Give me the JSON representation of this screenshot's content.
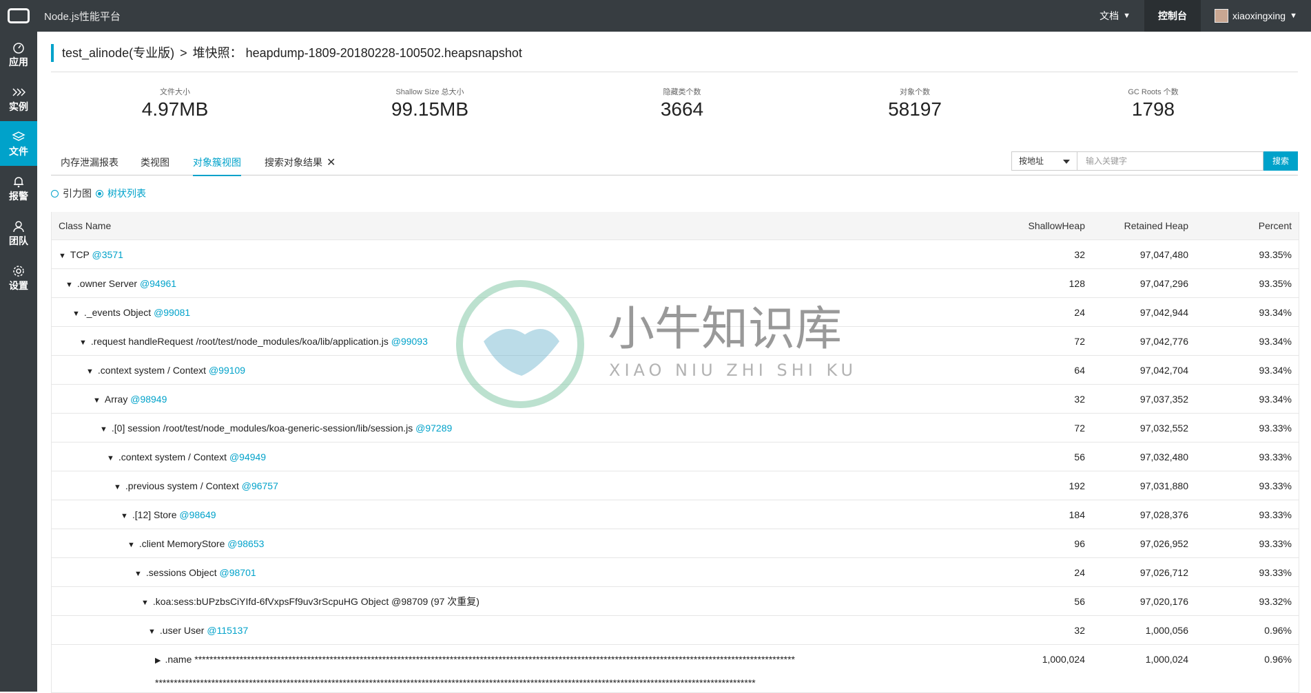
{
  "app": {
    "title": "Node.js性能平台"
  },
  "topnav": {
    "docs": "文档",
    "console": "控制台",
    "user": "xiaoxingxing"
  },
  "sidebar": {
    "items": [
      {
        "label": "应用",
        "icon": "dashboard-icon"
      },
      {
        "label": "实例",
        "icon": "chevrons-icon"
      },
      {
        "label": "文件",
        "icon": "layers-icon"
      },
      {
        "label": "报警",
        "icon": "bell-icon"
      },
      {
        "label": "团队",
        "icon": "user-icon"
      },
      {
        "label": "设置",
        "icon": "gear-icon"
      }
    ]
  },
  "breadcrumb": {
    "app": "test_alinode(专业版)",
    "sep": ">",
    "page": "堆快照： heapdump-1809-20180228-100502.heapsnapshot"
  },
  "stats": [
    {
      "label": "文件大小",
      "value": "4.97MB"
    },
    {
      "label": "Shallow Size 总大小",
      "value": "99.15MB"
    },
    {
      "label": "隐藏类个数",
      "value": "3664"
    },
    {
      "label": "对象个数",
      "value": "58197"
    },
    {
      "label": "GC Roots 个数",
      "value": "1798"
    }
  ],
  "tabs": [
    "内存泄漏报表",
    "类视图",
    "对象簇视图",
    "搜索对象结果"
  ],
  "search": {
    "mode": "按地址",
    "placeholder": "输入关键字",
    "button": "搜索"
  },
  "view_options": [
    "引力图",
    "树状列表"
  ],
  "table": {
    "headers": {
      "name": "Class Name",
      "shallow": "ShallowHeap",
      "retained": "Retained Heap",
      "percent": "Percent"
    },
    "rows": [
      {
        "name": "TCP",
        "addr": "@3571",
        "shallow": "32",
        "retained": "97,047,480",
        "percent": "93.35%"
      },
      {
        "name": ".owner Server",
        "addr": "@94961",
        "shallow": "128",
        "retained": "97,047,296",
        "percent": "93.35%"
      },
      {
        "name": "._events Object",
        "addr": "@99081",
        "shallow": "24",
        "retained": "97,042,944",
        "percent": "93.34%"
      },
      {
        "name": ".request handleRequest /root/test/node_modules/koa/lib/application.js",
        "addr": "@99093",
        "shallow": "72",
        "retained": "97,042,776",
        "percent": "93.34%"
      },
      {
        "name": ".context system / Context",
        "addr": "@99109",
        "shallow": "64",
        "retained": "97,042,704",
        "percent": "93.34%"
      },
      {
        "name": "Array",
        "addr": "@98949",
        "shallow": "32",
        "retained": "97,037,352",
        "percent": "93.34%"
      },
      {
        "name": ".[0] session /root/test/node_modules/koa-generic-session/lib/session.js",
        "addr": "@97289",
        "shallow": "72",
        "retained": "97,032,552",
        "percent": "93.33%"
      },
      {
        "name": ".context system / Context",
        "addr": "@94949",
        "shallow": "56",
        "retained": "97,032,480",
        "percent": "93.33%"
      },
      {
        "name": ".previous system / Context",
        "addr": "@96757",
        "shallow": "192",
        "retained": "97,031,880",
        "percent": "93.33%"
      },
      {
        "name": ".[12] Store",
        "addr": "@98649",
        "shallow": "184",
        "retained": "97,028,376",
        "percent": "93.33%"
      },
      {
        "name": ".client MemoryStore",
        "addr": "@98653",
        "shallow": "96",
        "retained": "97,026,952",
        "percent": "93.33%"
      },
      {
        "name": ".sessions Object",
        "addr": "@98701",
        "shallow": "24",
        "retained": "97,026,712",
        "percent": "93.33%"
      },
      {
        "name": ".koa:sess:bUPzbsCiYIfd-6fVxpsFf9uv3rScpuHG Object @98709 (97 次重复)",
        "addr": "",
        "shallow": "56",
        "retained": "97,020,176",
        "percent": "93.32%"
      },
      {
        "name": ".user User",
        "addr": "@115137",
        "shallow": "32",
        "retained": "1,000,056",
        "percent": "0.96%"
      },
      {
        "name": ".name ****************************************************************************************************************************************************************",
        "addr": "",
        "shallow": "1,000,024",
        "retained": "1,000,024",
        "percent": "0.96%"
      },
      {
        "name": "****************************************************************************************************************************************************************",
        "addr": "",
        "shallow": "",
        "retained": "",
        "percent": ""
      }
    ]
  },
  "watermark": {
    "cn": "小牛知识库",
    "en": "XIAO NIU ZHI SHI KU"
  }
}
